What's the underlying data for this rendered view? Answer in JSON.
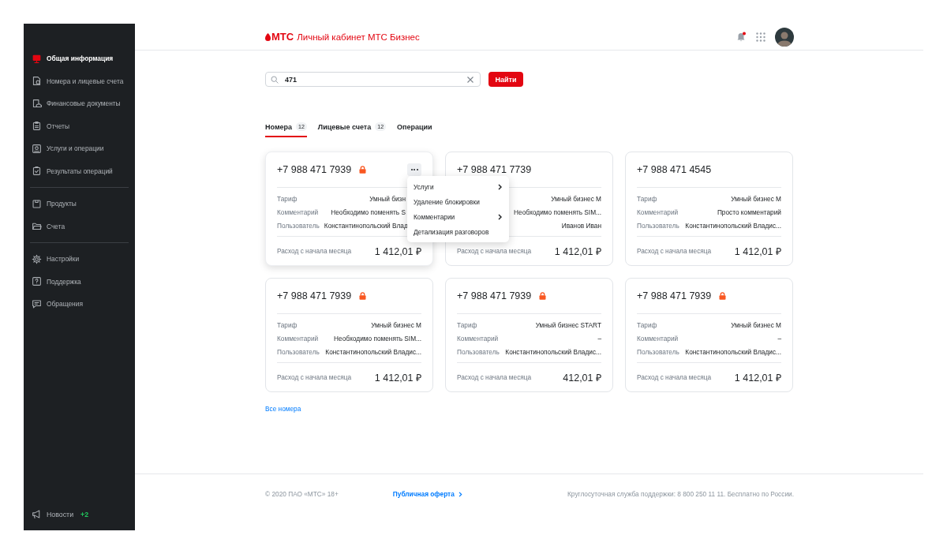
{
  "sidebar": {
    "sections": [
      {
        "items": [
          {
            "label": "Общая информация",
            "selected": true
          },
          {
            "label": "Номера и лицевые счета",
            "selected": false
          },
          {
            "label": "Финансовые документы",
            "selected": false
          },
          {
            "label": "Отчеты",
            "selected": false
          },
          {
            "label": "Услуги и операции",
            "selected": false
          },
          {
            "label": "Результаты операций",
            "selected": false
          }
        ]
      },
      {
        "items": [
          {
            "label": "Продукты",
            "selected": false
          },
          {
            "label": "Счета",
            "selected": false
          }
        ]
      },
      {
        "items": [
          {
            "label": "Настройки",
            "selected": false
          },
          {
            "label": "Поддержка",
            "selected": false
          },
          {
            "label": "Обращения",
            "selected": false
          }
        ]
      }
    ],
    "news": {
      "label": "Новости",
      "count": "+2"
    }
  },
  "header": {
    "logo": "МТС",
    "title": "Личный кабинет МТС Бизнес",
    "notification_unread": true
  },
  "search": {
    "value": "471",
    "button": "Найти"
  },
  "tabs": [
    {
      "label": "Номера",
      "count": "12",
      "selected": true
    },
    {
      "label": "Лицевые счета",
      "count": "12",
      "selected": false
    },
    {
      "label": "Операции",
      "selected": false
    }
  ],
  "cards": [
    {
      "phone": "+7 988 471 7939",
      "locked": true,
      "elevated": true,
      "rows": [
        {
          "label": "Тариф",
          "value": "Умный бизн"
        },
        {
          "label": "Комментарий",
          "value": "Необходимо поменять S"
        },
        {
          "label": "Пользователь",
          "value": "Константинопольский Влад"
        }
      ],
      "total_label": "Расход с начала месяца",
      "total": "1 412,01 ₽",
      "menu": [
        {
          "label": "Услуги",
          "submenu": true
        },
        {
          "label": "Удаление блокировки",
          "submenu": false
        },
        {
          "label": "Комментарии",
          "submenu": true
        },
        {
          "label": "Детализация разговоров",
          "submenu": false
        }
      ]
    },
    {
      "phone": "+7 988 471 7739",
      "locked": false,
      "elevated": false,
      "rows": [
        {
          "value": "Умный бизнес М"
        },
        {
          "value": "Необходимо поменять SIM..."
        },
        {
          "value": "Иванов Иван"
        }
      ],
      "total_label": "Расход с начала месяца",
      "total": "1 412,01 ₽"
    },
    {
      "phone": "+7 988 471 4545",
      "locked": false,
      "elevated": false,
      "rows": [
        {
          "label": "Тариф",
          "value": "Умный бизнес М"
        },
        {
          "label": "Комментарий",
          "value": "Просто комментарий"
        },
        {
          "label": "Пользователь",
          "value": "Константинопольский Владис..."
        }
      ],
      "total_label": "Расход с начала месяца",
      "total": "1 412,01 ₽"
    },
    {
      "phone": "+7 988 471 7939",
      "locked": true,
      "elevated": false,
      "rows": [
        {
          "label": "Тариф",
          "value": "Умный бизнес М"
        },
        {
          "label": "Комментарий",
          "value": "Необходимо поменять SIM..."
        },
        {
          "label": "Пользователь",
          "value": "Константинопольский Владис..."
        }
      ],
      "total_label": "Расход с начала месяца",
      "total": "1 412,01 ₽"
    },
    {
      "phone": "+7 988 471 7939",
      "locked": true,
      "elevated": false,
      "rows": [
        {
          "label": "Тариф",
          "value": "Умный бизнес START"
        },
        {
          "label": "Комментарий",
          "value": "–"
        },
        {
          "label": "Пользователь",
          "value": "Константинопольский Владис..."
        }
      ],
      "total_label": "Расход с начала месяца",
      "total": "412,01 ₽"
    },
    {
      "phone": "+7 988 471 7939",
      "locked": true,
      "elevated": false,
      "rows": [
        {
          "label": "Тариф",
          "value": "Умный бизнес М"
        },
        {
          "label": "Комментарий",
          "value": "–"
        },
        {
          "label": "Пользователь",
          "value": "Константинопольский Владис..."
        }
      ],
      "total_label": "Расход с начала месяца",
      "total": "1 412,01 ₽"
    }
  ],
  "all_link": "Все номера",
  "footer": {
    "copyright": "© 2020 ПАО «МТС» 18+",
    "offer_link": "Публичная оферта",
    "support": "Круглосуточная служба поддержки: 8 800 250 11 11. Бесплатно по России."
  }
}
